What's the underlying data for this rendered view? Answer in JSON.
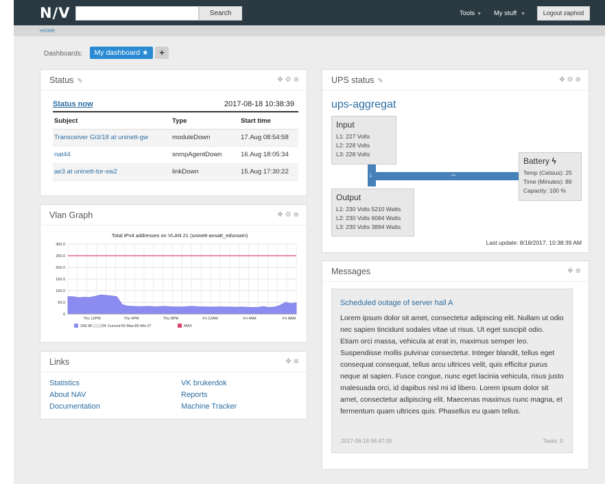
{
  "header": {
    "logo": "N∕V",
    "search_value": "",
    "search_button": "Search",
    "tools": "Tools",
    "my_stuff": "My stuff",
    "logout": "Logout zaphod"
  },
  "breadcrumb": "HOME",
  "dashboards": {
    "label": "Dashboards:",
    "active": "My dashboard",
    "add": "+"
  },
  "status_widget": {
    "title": "Status",
    "status_now": "Status now",
    "timestamp": "2017-08-18 10:38:39",
    "columns": [
      "Subject",
      "Type",
      "Start time"
    ],
    "rows": [
      {
        "subject": "Transceiver Gi3/18 at uninett-gw",
        "type": "moduleDown",
        "start": "17.Aug 08:54:58"
      },
      {
        "subject": "nat44",
        "type": "snmpAgentDown",
        "start": "16.Aug 18:05:34"
      },
      {
        "subject": "ae3 at uninett-tor-sw2",
        "type": "linkDown",
        "start": "15.Aug 17:30:22"
      }
    ]
  },
  "vlan_widget": {
    "title": "Vlan Graph"
  },
  "chart_data": {
    "type": "area",
    "title": "Total IPv4 addresses on VLAN 21 (uninett-ansatt_eduroam)",
    "ylim": [
      0,
      300
    ],
    "yticks": [
      "300.0",
      "250.0",
      "200.0",
      "150.0",
      "100.0",
      "50.0",
      "0"
    ],
    "xticks": [
      "Thu 12PM",
      "Thu 4PM",
      "Thu 8PM",
      "Fri 12AM",
      "Fri 4AM",
      "Fri 8AM"
    ],
    "grid": true,
    "series": [
      {
        "name": "158.38.░░░/24",
        "color": "#8c8cf0",
        "values": [
          75,
          74,
          70,
          72,
          71,
          76,
          82,
          80,
          78,
          74,
          40,
          34,
          33,
          32,
          32,
          33,
          31,
          32,
          33,
          31,
          31,
          30,
          32,
          33,
          31,
          31,
          30,
          30,
          31,
          30,
          30,
          29,
          30,
          29,
          28,
          29,
          32,
          28,
          30,
          37,
          50,
          45,
          48
        ]
      }
    ],
    "max_line": {
      "name": "MAX",
      "value": 250,
      "color": "#d9436d"
    },
    "legend": {
      "series_stats": "Current:50   Max:86   Min:27",
      "max_label": "MAX"
    }
  },
  "links_widget": {
    "title": "Links",
    "col1": [
      "Statistics",
      "About NAV",
      "Documentation"
    ],
    "col2": [
      "VK brukerdok",
      "Reports",
      "Machine Tracker"
    ]
  },
  "ups_widget": {
    "title": "UPS status",
    "name": "ups-aggregat",
    "input": {
      "label": "Input",
      "lines": [
        "L1: 227 Volts",
        "L2: 228 Volts",
        "L3: 228 Volts"
      ]
    },
    "output": {
      "label": "Output",
      "lines": [
        "L1: 230 Volts 5210 Watts",
        "L2: 230 Volts 6084 Watts",
        "L3: 230 Volts 3894 Watts"
      ]
    },
    "battery": {
      "label": "Battery",
      "lines": [
        "Temp (Celsius): 25",
        "Time (Minutes): 89",
        "Capacity: 100 %"
      ]
    },
    "last_update": "Last update: 8/18/2017, 10:38:39 AM"
  },
  "messages_widget": {
    "title": "Messages",
    "message_title": "Scheduled outage of server hall A",
    "message_body": "Lorem ipsum dolor sit amet, consectetur adipiscing elit. Nullam ut odio nec sapien tincidunt sodales vitae ut risus. Ut eget suscipit odio. Etiam orci massa, vehicula at erat in, maximus semper leo. Suspendisse mollis pulvinar consectetur. Integer blandit, tellus eget consequat consequat, tellus arcu ultrices velit, quis efficitur purus neque at sapien. Fusce congue, nunc eget lacinia vehicula, risus justo malesuada orci, id dapibus nisl mi id libero. Lorem ipsum dolor sit amet, consectetur adipiscing elit. Maecenas maximus nunc magna, et fermentum quam ultrices quis. Phasellus eu quam tellus.",
    "date": "2017-08-18 06:47:00",
    "tasks": "Tasks: 0"
  }
}
